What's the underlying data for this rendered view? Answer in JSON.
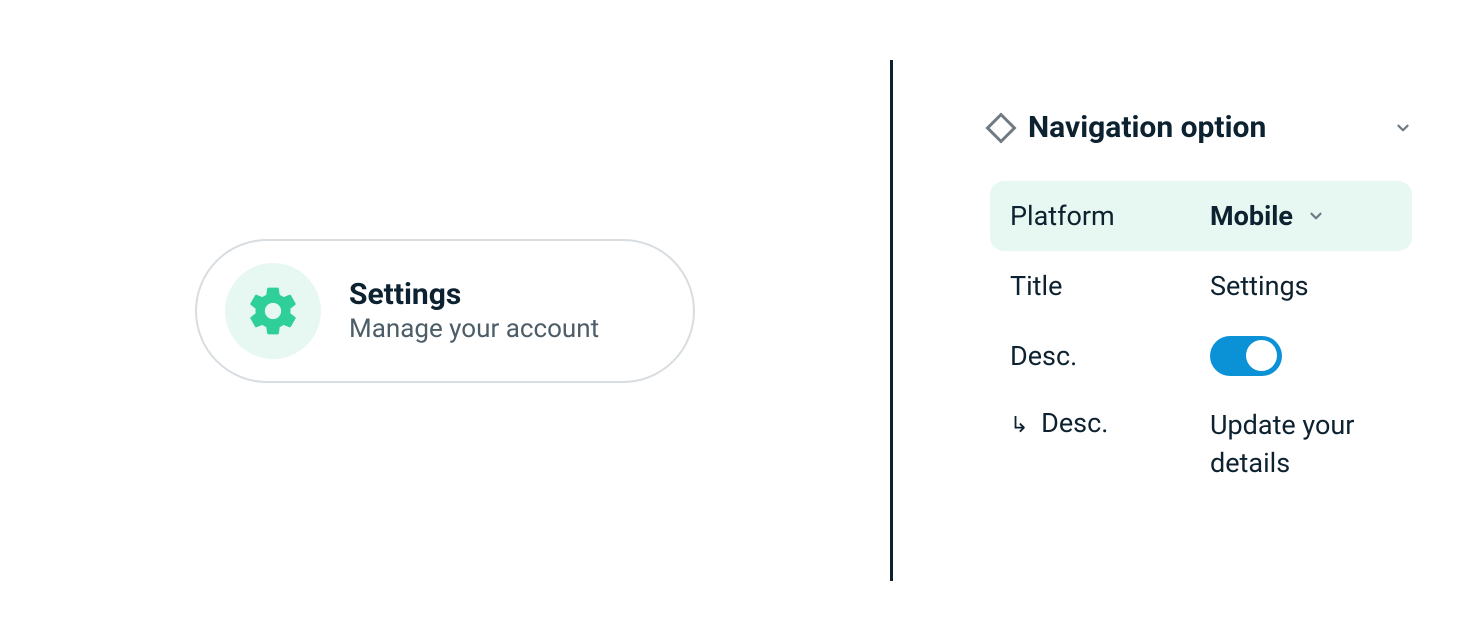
{
  "preview": {
    "title": "Settings",
    "description": "Manage your account",
    "icon": "gear-icon"
  },
  "inspector": {
    "header": "Navigation option",
    "platform": {
      "label": "Platform",
      "value": "Mobile"
    },
    "title": {
      "label": "Title",
      "value": "Settings"
    },
    "descToggle": {
      "label": "Desc.",
      "on": true
    },
    "descChild": {
      "label": "Desc.",
      "value": "Update your details"
    }
  },
  "colors": {
    "accent_teal": "#2fcf9a",
    "accent_bg": "#e6f8f1",
    "text_dark": "#0d2230",
    "text_muted": "#4d5d68",
    "toggle_on": "#0a91d6",
    "border_gray": "#d8dde1"
  }
}
